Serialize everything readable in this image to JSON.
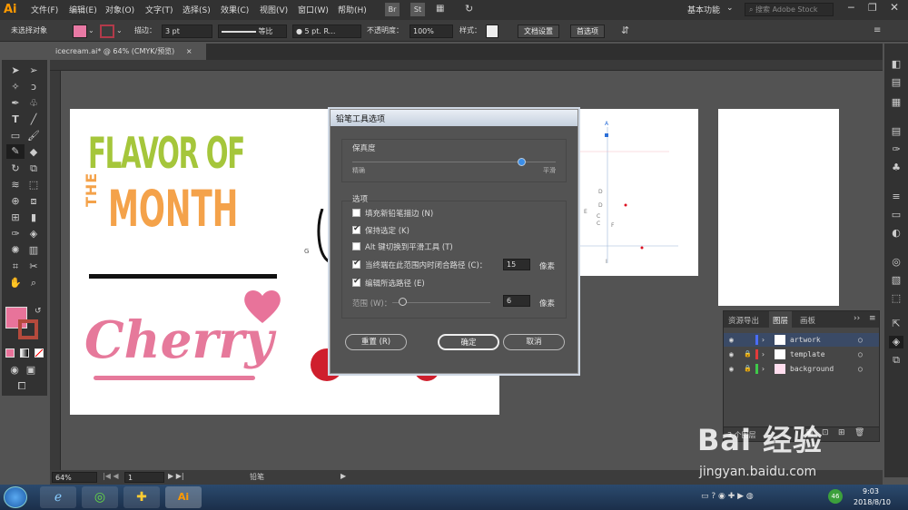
{
  "app": {
    "logo": "Ai"
  },
  "menu": [
    "文件(F)",
    "编辑(E)",
    "对象(O)",
    "文字(T)",
    "选择(S)",
    "效果(C)",
    "视图(V)",
    "窗口(W)",
    "帮助(H)"
  ],
  "menu_icons": [
    "Br",
    "St"
  ],
  "workspace": {
    "label": "基本功能",
    "search_placeholder": "搜索 Adobe Stock"
  },
  "control_bar": {
    "no_selection": "未选择对象",
    "stroke_label": "描边：",
    "stroke_weight": "3 pt",
    "stroke_profile": "等比",
    "brush": "5 pt. R...",
    "opacity_label": "不透明度：",
    "opacity_value": "100%",
    "style_label": "样式：",
    "doc_setup": "文档设置",
    "preferences": "首选项"
  },
  "document_tab": {
    "title": "icecream.ai* @ 64% (CMYK/预览)",
    "close": "×"
  },
  "artwork": {
    "flavor_line": "FLAVOR OF",
    "the_word": "THE",
    "month_word": "MONTH",
    "cherry_word": "Cherry",
    "heart_color": "#e8739a",
    "green": "#a5c63b",
    "orange": "#f4a24a",
    "pink": "#e6799b"
  },
  "template_marks": [
    "A",
    "D",
    "E",
    "D",
    "F",
    "C",
    "C",
    "I",
    "G"
  ],
  "dialog": {
    "title": "铅笔工具选项",
    "fidelity_heading": "保真度",
    "fidelity_left": "精确",
    "fidelity_right": "平滑",
    "fidelity_value": 0.83,
    "options_heading": "选项",
    "opt_fill": "填充新铅笔描边 (N)",
    "opt_keep": "保持选定 (K)",
    "opt_alt": "Alt 键切换到平滑工具 (T)",
    "opt_close": "当终端在此范围内时闭合路径 (C)：",
    "close_value": "15",
    "close_unit": "像素",
    "opt_edit": "编辑所选路径 (E)",
    "range_label": "范围 (W)：",
    "range_value": "6",
    "range_unit": "像素",
    "range_fraction": 0.1,
    "reset": "重置 (R)",
    "ok": "确定",
    "cancel": "取消"
  },
  "layers_panel": {
    "tabs": [
      "资源导出",
      "图层",
      "画板"
    ],
    "layers": [
      {
        "name": "artwork",
        "color": "#4a6cf7"
      },
      {
        "name": "template",
        "color": "#e23b3b"
      },
      {
        "name": "background",
        "color": "#3ec94a"
      }
    ],
    "count": "3 个图层"
  },
  "status_bar": {
    "zoom": "64%",
    "page": "1",
    "tool": "铅笔"
  },
  "taskbar": {
    "time": "9:03",
    "date": "2018/8/10",
    "badge": "46"
  },
  "watermark": {
    "brand": "Bai 经验",
    "url": "jingyan.baidu.com"
  }
}
